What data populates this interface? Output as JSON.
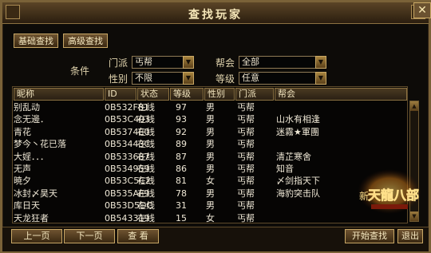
{
  "window": {
    "title": "查找玩家",
    "close_label": "✕"
  },
  "tabs": {
    "basic": "基础查找",
    "advanced": "高级查找"
  },
  "filters": {
    "conditions_label": "条件",
    "sect_label": "门派",
    "sect_value": "丐帮",
    "gender_label": "性别",
    "gender_value": "不限",
    "guild_label": "帮会",
    "guild_value": "全部",
    "level_label": "等级",
    "level_value": "任意"
  },
  "table": {
    "headers": [
      "昵称",
      "ID",
      "状态",
      "等级",
      "性别",
      "门派",
      "帮会"
    ],
    "rows": [
      {
        "name": "别乱动",
        "id": "0B532F81",
        "status": "在线",
        "level": "97",
        "gender": "男",
        "sect": "丐帮",
        "guild": ""
      },
      {
        "name": "念无邊．",
        "id": "0B53C403",
        "status": "在线",
        "level": "93",
        "gender": "男",
        "sect": "丐帮",
        "guild": "山水有相逢"
      },
      {
        "name": "青花",
        "id": "0B5374E0",
        "status": "在线",
        "level": "92",
        "gender": "男",
        "sect": "丐帮",
        "guild": "迷霧★軍團"
      },
      {
        "name": "梦今丶花已落",
        "id": "0B53443C",
        "status": "在线",
        "level": "89",
        "gender": "男",
        "sect": "丐帮",
        "guild": ""
      },
      {
        "name": "大婬．．．",
        "id": "0B533687",
        "status": "在线",
        "level": "87",
        "gender": "男",
        "sect": "丐帮",
        "guild": "清芷寒舍"
      },
      {
        "name": "无声",
        "id": "0B534959",
        "status": "在线",
        "level": "86",
        "gender": "男",
        "sect": "丐帮",
        "guild": "知音"
      },
      {
        "name": "暁夕",
        "id": "0B53C5C2",
        "status": "在线",
        "level": "81",
        "gender": "女",
        "sect": "丐帮",
        "guild": "〆剑指天下"
      },
      {
        "name": "冰封〆昊天",
        "id": "0B535AF9",
        "status": "在线",
        "level": "78",
        "gender": "男",
        "sect": "丐帮",
        "guild": "海豹突击队"
      },
      {
        "name": "库日天",
        "id": "0B53D5DC",
        "status": "在线",
        "level": "31",
        "gender": "男",
        "sect": "丐帮",
        "guild": ""
      },
      {
        "name": "天龙狂者",
        "id": "0B543319",
        "status": "在线",
        "level": "15",
        "gender": "女",
        "sect": "丐帮",
        "guild": ""
      }
    ]
  },
  "buttons": {
    "prev": "上一页",
    "next": "下一页",
    "view": "查 看",
    "start": "开始查找",
    "exit": "退出"
  },
  "logo": {
    "text": "天龍八部",
    "prefix": "新"
  },
  "colors": {
    "gold": "#c8a766",
    "dark": "#0d0b08"
  }
}
